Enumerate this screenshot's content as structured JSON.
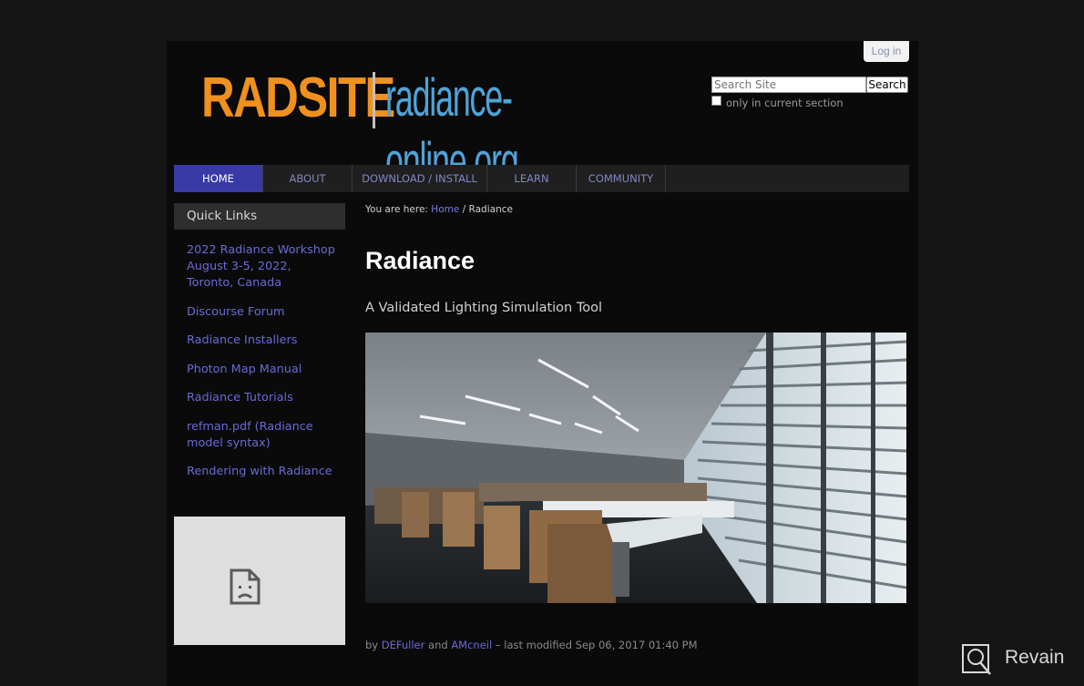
{
  "header": {
    "login_label": "Log in",
    "logo_left": "RADSITE",
    "logo_right": "radiance-online.org",
    "search_placeholder": "Search Site",
    "search_button": "Search",
    "only_current_section": "only in current section"
  },
  "nav": {
    "items": [
      {
        "label": "HOME",
        "active": true
      },
      {
        "label": "ABOUT"
      },
      {
        "label": "DOWNLOAD / INSTALL"
      },
      {
        "label": "LEARN"
      },
      {
        "label": "COMMUNITY"
      }
    ]
  },
  "sidebar": {
    "heading": "Quick Links",
    "items": [
      {
        "label": "2022 Radiance Workshop\nAugust 3-5, 2022,\nToronto, Canada"
      },
      {
        "label": "Discourse Forum"
      },
      {
        "label": "Radiance Installers"
      },
      {
        "label": "Photon Map Manual"
      },
      {
        "label": "Radiance Tutorials"
      },
      {
        "label": "refman.pdf (Radiance\nmodel syntax)"
      },
      {
        "label": "Rendering with Radiance"
      }
    ],
    "broken_image_icon": "broken-image-icon"
  },
  "breadcrumb": {
    "prefix": "You are here:",
    "home": "Home",
    "separator": "/",
    "current": "Radiance"
  },
  "content": {
    "title": "Radiance",
    "subtitle": "A Validated Lighting Simulation Tool",
    "image_subject": "office-interior-rendering"
  },
  "byline": {
    "by": "by",
    "author1": "DEFuller",
    "and": "and",
    "author2": "AMcneil",
    "modified": "– last modified Sep 06, 2017 01:40 PM"
  },
  "watermark": {
    "text": "Revain"
  },
  "colors": {
    "logo_orange": "#f0901e",
    "logo_blue": "#4fa3d8",
    "nav_active": "#3a3aa6",
    "link": "#6a6ad8"
  }
}
